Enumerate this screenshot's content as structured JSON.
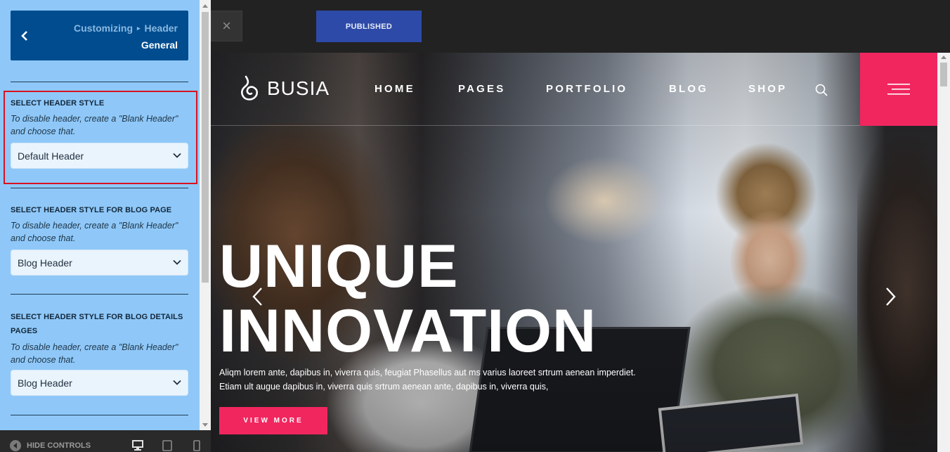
{
  "sidebar": {
    "breadcrumb_prefix": "Customizing",
    "breadcrumb_separator": "▸",
    "breadcrumb_section": "Header",
    "section_title": "General",
    "groups": [
      {
        "title": "SELECT HEADER STYLE",
        "description": "To disable header, create a \"Blank Header\" and choose that.",
        "selected": "Default Header"
      },
      {
        "title": "SELECT HEADER STYLE FOR BLOG PAGE",
        "description": "To disable header, create a \"Blank Header\" and choose that.",
        "selected": "Blog Header"
      },
      {
        "title": "SELECT HEADER STYLE FOR BLOG DETAILS PAGES",
        "description": "To disable header, create a \"Blank Header\" and choose that.",
        "selected": "Blog Header"
      }
    ],
    "footer": {
      "hide_controls_label": "HIDE CONTROLS",
      "devices": [
        "desktop-icon",
        "tablet-icon",
        "mobile-icon"
      ]
    }
  },
  "toolbar": {
    "close_label": "×",
    "publish_label": "PUBLISHED"
  },
  "preview": {
    "logo_text": "BUSIA",
    "nav": [
      "HOME",
      "PAGES",
      "PORTFOLIO",
      "BLOG",
      "SHOP"
    ],
    "hero": {
      "title_line1": "UNIQUE",
      "title_line2": "INNOVATION",
      "text_line1": "Aliqm lorem ante, dapibus in, viverra quis, feugiat Phasellus aut ms varius laoreet srtrum aenean imperdiet.",
      "text_line2": "Etiam ult augue dapibus in, viverra quis srtrum aenean ante, dapibus in, viverra quis,",
      "button_label": "VIEW MORE"
    }
  },
  "colors": {
    "sidebar_bg": "#8fc8f8",
    "panel_blue": "#004c8f",
    "publish_blue": "#2d4aa8",
    "accent_pink": "#f1265f",
    "highlight_red": "#d9121f"
  }
}
